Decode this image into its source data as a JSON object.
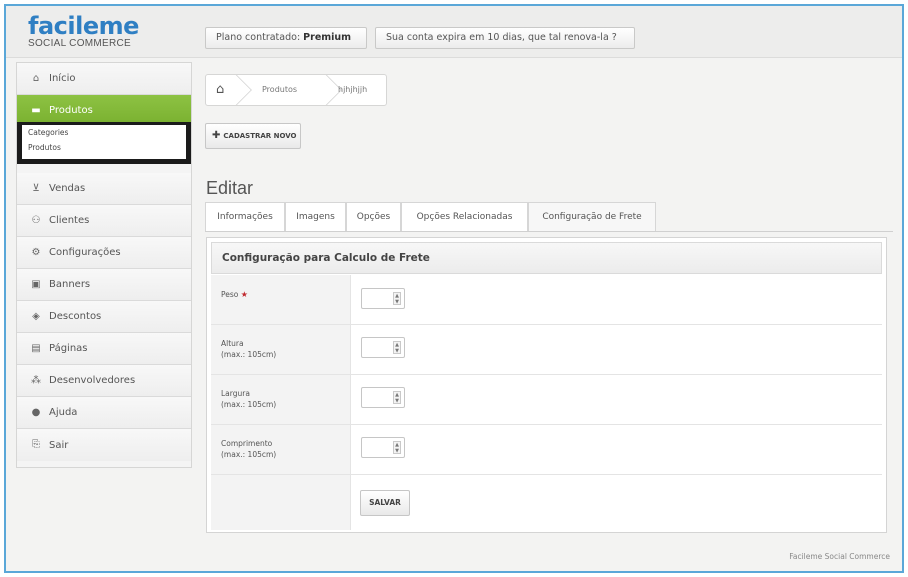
{
  "brand": {
    "name": "facileme",
    "tagline": "SOCIAL COMMERCE",
    "color": "#2f7fc3"
  },
  "header": {
    "plan_prefix": "Plano contratado: ",
    "plan_value": "Premium",
    "expiry_notice": "Sua conta expira em 10 dias, que tal renova-la ?"
  },
  "sidebar": {
    "accent": "#80b637",
    "items": [
      {
        "label": "Início",
        "icon": "home-icon"
      },
      {
        "label": "Produtos",
        "icon": "folder-icon"
      },
      {
        "label": "Vendas",
        "icon": "cart-icon"
      },
      {
        "label": "Clientes",
        "icon": "users-icon"
      },
      {
        "label": "Configurações",
        "icon": "cogs-icon"
      },
      {
        "label": "Banners",
        "icon": "image-icon"
      },
      {
        "label": "Descontos",
        "icon": "tag-icon"
      },
      {
        "label": "Páginas",
        "icon": "page-icon"
      },
      {
        "label": "Desenvolvedores",
        "icon": "sitemap-icon"
      },
      {
        "label": "Ajuda",
        "icon": "help-icon"
      },
      {
        "label": "Sair",
        "icon": "logout-icon"
      }
    ],
    "submenu": [
      "Categories",
      "Produtos"
    ]
  },
  "breadcrumb": {
    "home_icon": "home-icon",
    "items": [
      "Produtos",
      "hjhjhjjh"
    ]
  },
  "actions": {
    "add_new": "CADASTRAR NOVO"
  },
  "page": {
    "title": "Editar"
  },
  "tabs": [
    "Informações",
    "Imagens",
    "Opções",
    "Opções Relacionadas",
    "Configuração de Frete"
  ],
  "form": {
    "heading": "Configuração para Calculo de Frete",
    "fields": [
      {
        "label": "Peso",
        "hint": "",
        "required": "★",
        "value": ""
      },
      {
        "label": "Altura",
        "hint": "(max.: 105cm)",
        "value": ""
      },
      {
        "label": "Largura",
        "hint": "(max.: 105cm)",
        "value": ""
      },
      {
        "label": "Comprimento",
        "hint": "(max.: 105cm)",
        "value": ""
      }
    ],
    "save": "SALVAR"
  },
  "footer": {
    "text": "Facileme Social Commerce"
  }
}
